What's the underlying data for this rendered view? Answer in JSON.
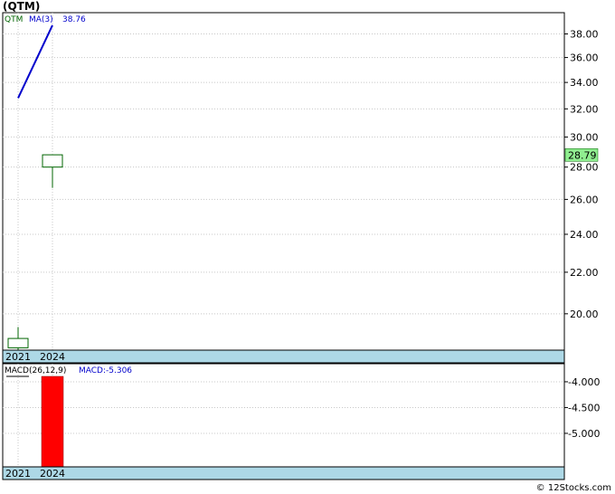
{
  "title": "(QTM)",
  "footer": "© 12Stocks.com",
  "chart_data": [
    {
      "type": "candlestick",
      "legend_symbol": "QTM",
      "legend_ma_label": "MA(3)",
      "legend_ma_value": "38.76",
      "x_labels": [
        "2021",
        "2024"
      ],
      "y_ticks": [
        20.0,
        22.0,
        24.0,
        26.0,
        28.0,
        30.0,
        32.0,
        34.0,
        36.0,
        38.0
      ],
      "ylim": [
        18.4,
        39.9
      ],
      "log_scale": true,
      "last_price": "28.79",
      "candles": [
        {
          "x": "2021",
          "open": 18.5,
          "close": 18.9,
          "high": 19.4,
          "low": 18.4
        },
        {
          "x": "2024",
          "open": 28.0,
          "close": 28.8,
          "high": 28.8,
          "low": 26.7
        }
      ],
      "ma": [
        {
          "x": "2021",
          "value": 32.8
        },
        {
          "x": "2024",
          "value": 38.76
        }
      ],
      "colors": {
        "up": "#006400",
        "ma": "#0000cc",
        "price_label_bg": "#90ee90",
        "axis_band": "#add8e6"
      }
    },
    {
      "type": "bar",
      "legend_label": "MACD(26,12,9)",
      "legend_value_label": "MACD:-5.306",
      "x_labels": [
        "2021",
        "2024"
      ],
      "y_ticks": [
        -4.0,
        -4.5,
        -5.0
      ],
      "ylim": [
        -5.65,
        -3.65
      ],
      "bars": [
        {
          "x": "2024",
          "value": -5.306
        }
      ],
      "colors": {
        "bar": "#ff0000"
      }
    }
  ]
}
